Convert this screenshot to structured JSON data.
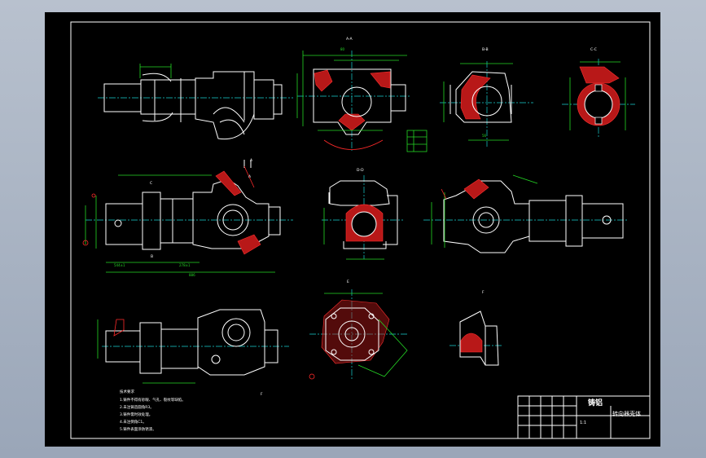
{
  "drawing": {
    "sections": {
      "aa": "A-A",
      "bb": "B-B",
      "cc": "C-C",
      "dd": "D-D",
      "e": "E",
      "f": "F"
    },
    "cut_marks": {
      "a_top": "A",
      "a_bottom": "A",
      "b": "B",
      "c": "C",
      "d": "D",
      "e": "E",
      "f": "F"
    },
    "dims": {
      "d_total": "886",
      "d_a": "278±1",
      "d_b": "544±1",
      "d_c": "80",
      "d_d": "56"
    },
    "notes": [
      "技术要求",
      "1.铸件不得有砂眼、气孔、裂纹等缺陷。",
      "2.未注铸造圆角R3。",
      "3.铸件需时效处理。",
      "4.未注倒角C1。",
      "5.铸件表面涂防锈漆。"
    ]
  },
  "title_block": {
    "material": "铸铝",
    "part_name": "转向器壳体",
    "scale": "1:1"
  },
  "colors": {
    "sheet": "#000000",
    "outline": "#ffffff",
    "dimension": "#25d825",
    "center": "#18d0d0",
    "section": "#ff2a2a"
  }
}
